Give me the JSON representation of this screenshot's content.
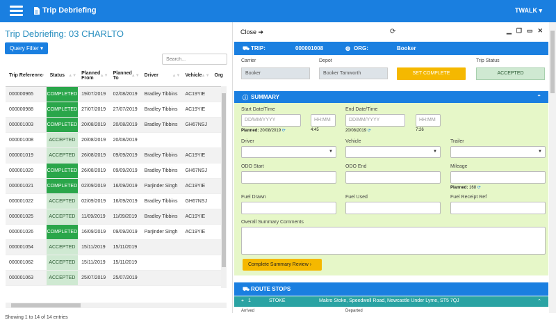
{
  "header": {
    "title": "Trip Debriefing",
    "user": "TWALK ▾"
  },
  "page": {
    "title": "Trip Debriefing: 03 CHARLTO",
    "query_filter": "Query Filter ▾",
    "search_placeholder": "Search...",
    "info": "Showing 1 to 14 of 14 entries"
  },
  "table": {
    "columns": [
      "Trip Reference",
      "Status",
      "Planned From",
      "Planned To",
      "Driver",
      "Vehicle",
      "Org"
    ],
    "rows": [
      {
        "ref": "000000965",
        "status": "COMPLETED",
        "from": "19/07/2019",
        "to": "02/08/2019",
        "driver": "Bradley Tibbins",
        "vehicle": "AC19YIE"
      },
      {
        "ref": "000000988",
        "status": "COMPLETED",
        "from": "27/07/2019",
        "to": "27/07/2019",
        "driver": "Bradley Tibbins",
        "vehicle": "AC19YIE"
      },
      {
        "ref": "000001003",
        "status": "COMPLETED",
        "from": "20/08/2019",
        "to": "20/08/2019",
        "driver": "Bradley Tibbins",
        "vehicle": "GH67NSJ"
      },
      {
        "ref": "000001008",
        "status": "ACCEPTED",
        "from": "20/08/2019",
        "to": "20/08/2019",
        "driver": "",
        "vehicle": ""
      },
      {
        "ref": "000001019",
        "status": "ACCEPTED",
        "from": "26/08/2019",
        "to": "09/09/2019",
        "driver": "Bradley Tibbins",
        "vehicle": "AC19YIE"
      },
      {
        "ref": "000001020",
        "status": "COMPLETED",
        "from": "26/08/2019",
        "to": "09/09/2019",
        "driver": "Bradley Tibbins",
        "vehicle": "GH67NSJ"
      },
      {
        "ref": "000001021",
        "status": "COMPLETED",
        "from": "02/09/2019",
        "to": "16/09/2019",
        "driver": "Parjinder Singh",
        "vehicle": "AC19YIE"
      },
      {
        "ref": "000001022",
        "status": "ACCEPTED",
        "from": "02/09/2019",
        "to": "16/09/2019",
        "driver": "Bradley Tibbins",
        "vehicle": "GH67NSJ"
      },
      {
        "ref": "000001025",
        "status": "ACCEPTED",
        "from": "11/09/2019",
        "to": "11/09/2019",
        "driver": "Bradley Tibbins",
        "vehicle": "AC19YIE"
      },
      {
        "ref": "000001026",
        "status": "COMPLETED",
        "from": "16/09/2019",
        "to": "09/09/2019",
        "driver": "Parjinder Singh",
        "vehicle": "AC19YIE"
      },
      {
        "ref": "000001054",
        "status": "ACCEPTED",
        "from": "15/11/2019",
        "to": "15/11/2019",
        "driver": "",
        "vehicle": ""
      },
      {
        "ref": "000001062",
        "status": "ACCEPTED",
        "from": "15/11/2019",
        "to": "15/11/2019",
        "driver": "",
        "vehicle": ""
      },
      {
        "ref": "000001063",
        "status": "ACCEPTED",
        "from": "25/07/2019",
        "to": "25/07/2019",
        "driver": "",
        "vehicle": ""
      }
    ]
  },
  "detail": {
    "close": "Close ➔",
    "trip_label": "TRIP:",
    "trip_value": "000001008",
    "org_label": "ORG:",
    "org_value": "Booker",
    "carrier_label": "Carrier",
    "carrier_value": "Booker",
    "depot_label": "Depot",
    "depot_value": "Booker Tamworth",
    "set_complete": "SET COMPLETE",
    "trip_status_label": "Trip Status",
    "trip_status_value": "ACCEPTED",
    "summary_label": "SUMMARY",
    "start_label": "Start Date/Time",
    "end_label": "End Date/Time",
    "date_placeholder": "DD/MM/YYYY",
    "time_placeholder": "HH:MM",
    "planned_start_label": "Planned:",
    "planned_start_date": "20/08/2019",
    "planned_start_time": "4:45",
    "planned_end_date": "20/08/2019",
    "planned_end_time": "7:26",
    "driver_label": "Driver",
    "vehicle_label": "Vehicle",
    "trailer_label": "Trailer",
    "odo_start_label": "ODO Start",
    "odo_end_label": "ODO End",
    "mileage_label": "Mileage",
    "mileage_planned_label": "Planned:",
    "mileage_planned_value": "168",
    "fuel_drawn_label": "Fuel Drawn",
    "fuel_used_label": "Fuel Used",
    "fuel_receipt_label": "Fuel Receipt Ref",
    "comments_label": "Overall Summary Comments",
    "complete_review": "Complete Summary Review ›",
    "route_stops_label": "ROUTE STOPS",
    "stop_num": "1",
    "stop_name": "STOKE",
    "stop_address": "Makro Stoke, Speedwell Road, Newcastle Under Lyme, ST5 7QJ",
    "arrived_label": "Arrived",
    "departed_label": "Departed"
  },
  "colors": {
    "primary": "#1a7fe0",
    "completed": "#2aa64a",
    "accepted": "#cfe9d2",
    "warning": "#f5b800",
    "summary_bg": "#e6f7c8",
    "stop_bar": "#2aa3a3"
  }
}
